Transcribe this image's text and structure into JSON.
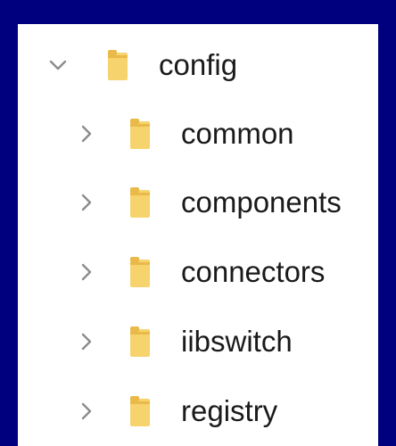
{
  "colors": {
    "background": "#00007f",
    "panel": "#ffffff",
    "folder": "#f6d36c",
    "folder_shade": "#e9b949",
    "chevron": "#8c8c8c",
    "text": "#1a1a1a"
  },
  "tree": {
    "root": {
      "label": "config",
      "icon": "folder-icon",
      "expanded": true
    },
    "children": [
      {
        "label": "common",
        "icon": "folder-icon",
        "expanded": false
      },
      {
        "label": "components",
        "icon": "folder-icon",
        "expanded": false
      },
      {
        "label": "connectors",
        "icon": "folder-icon",
        "expanded": false
      },
      {
        "label": "iibswitch",
        "icon": "folder-icon",
        "expanded": false
      },
      {
        "label": "registry",
        "icon": "folder-icon",
        "expanded": false
      }
    ]
  }
}
